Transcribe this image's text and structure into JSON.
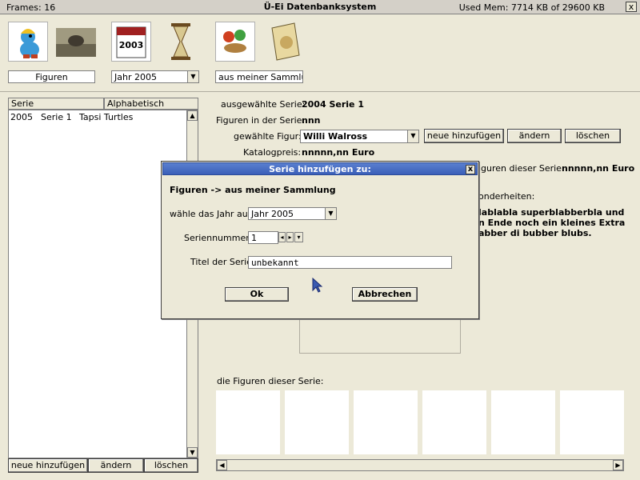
{
  "titlebar": {
    "frames": "Frames: 16",
    "title": "Ü-Ei Datenbanksystem",
    "memory": "Used Mem: 7714 KB of 29600 KB",
    "close": "x"
  },
  "top": {
    "figures_field": "Figuren",
    "year_combo": "Jahr 2005",
    "collection_field": "aus meiner Sammlung"
  },
  "list": {
    "headers": [
      "Serie",
      "Alphabetisch"
    ],
    "rows": [
      {
        "year": "2005",
        "series": "Serie 1",
        "name": "Tapsi Turtles"
      }
    ],
    "buttons": {
      "add": "neue hinzufügen",
      "edit": "ändern",
      "delete": "löschen"
    }
  },
  "details": {
    "selected_series_label": "ausgewählte Serie:",
    "selected_series_value": "2004 Serie 1",
    "figures_in_series_label": "Figuren in der Serie:",
    "figures_in_series_value": "nnn",
    "chosen_figure_label": "gewählte Figur:",
    "chosen_figure_value": "Willi Walross",
    "add_button": "neue hinzufügen",
    "edit_button": "ändern",
    "delete_button": "löschen",
    "catalog_price_label": "Katalogpreis:",
    "catalog_price_value": "nnnnn,nn Euro",
    "series_price_label": "iguren dieser Serie:",
    "series_price_value": "nnnnn,nn Euro",
    "specials_label": "onderheiten:",
    "specials_lines": [
      "lablabla superblabberbla und",
      "n Ende noch ein kleines Extra",
      "abber di bubber blubs."
    ],
    "series_figures_label": "die Figuren dieser Serie:"
  },
  "dialog": {
    "title": "Serie hinzufügen zu:",
    "heading": "Figuren -> aus meiner Sammlung",
    "year_label": "wähle das Jahr aus:",
    "year_value": "Jahr 2005",
    "number_label": "Seriennummer:",
    "number_value": "1",
    "title_label": "Titel der Serie:",
    "title_value": "unbekannt",
    "ok": "Ok",
    "cancel": "Abbrechen"
  }
}
